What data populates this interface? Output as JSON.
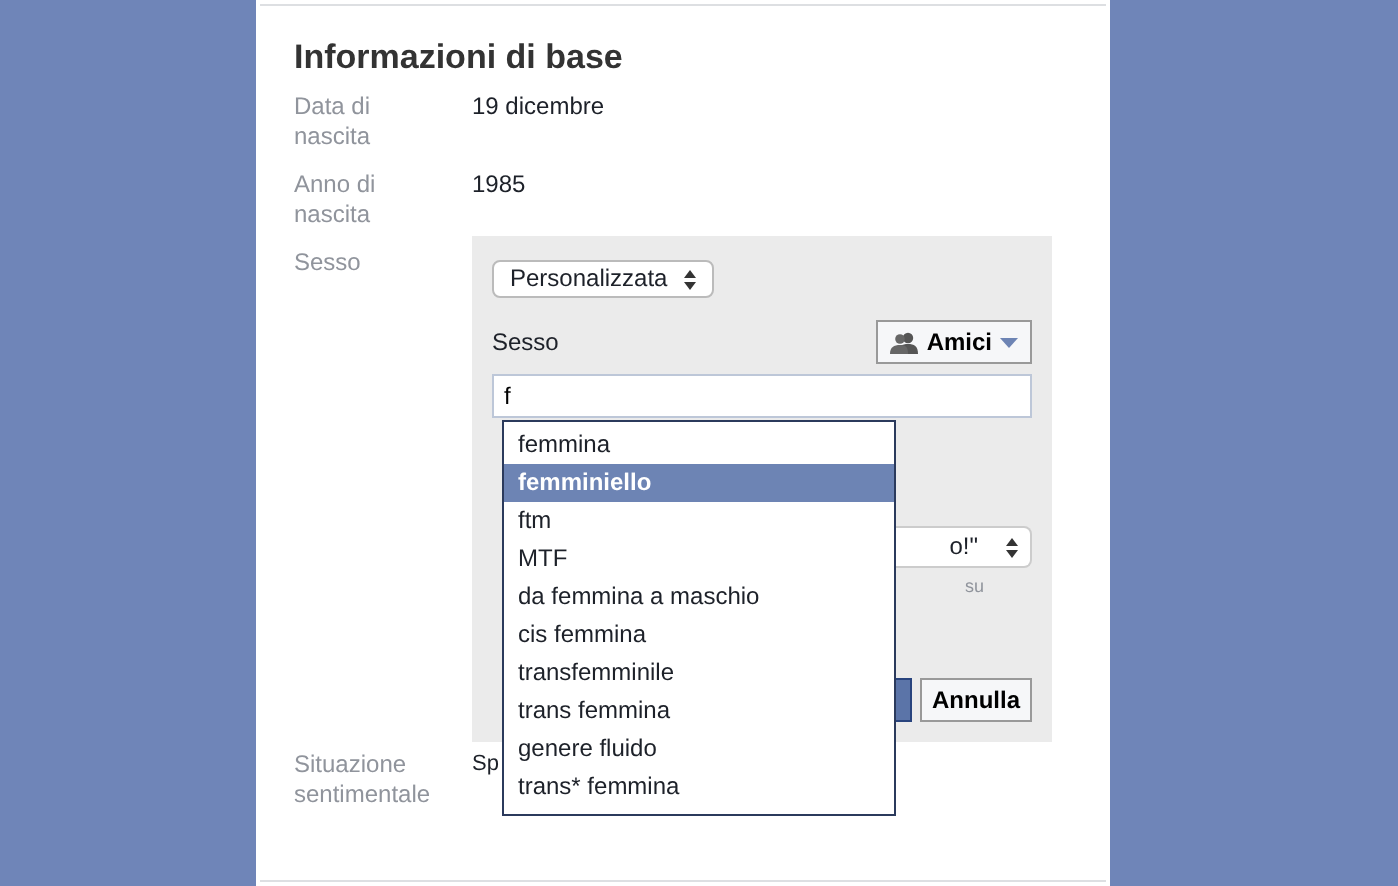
{
  "section": {
    "title": "Informazioni di base"
  },
  "fields": [
    {
      "label": "Data di nascita",
      "value": "19 dicembre"
    },
    {
      "label": "Anno di nascita",
      "value": "1985"
    }
  ],
  "gender": {
    "label": "Sesso",
    "mode_select": "Personalizzata",
    "field_label": "Sesso",
    "audience": "Amici",
    "input_value": "f",
    "pronoun_select": "o!\"",
    "pronoun_hint": "su",
    "cancel": "Annulla",
    "suggestions": [
      {
        "label": "femmina",
        "selected": false
      },
      {
        "label": "femminiello",
        "selected": true
      },
      {
        "label": "ftm",
        "selected": false
      },
      {
        "label": "MTF",
        "selected": false
      },
      {
        "label": "da femmina a maschio",
        "selected": false
      },
      {
        "label": "cis femmina",
        "selected": false
      },
      {
        "label": "transfemminile",
        "selected": false
      },
      {
        "label": "trans femmina",
        "selected": false
      },
      {
        "label": "genere fluido",
        "selected": false
      },
      {
        "label": "trans* femmina",
        "selected": false
      }
    ]
  },
  "relationship": {
    "label": "Situazione sentimentale",
    "value": "Sp"
  }
}
